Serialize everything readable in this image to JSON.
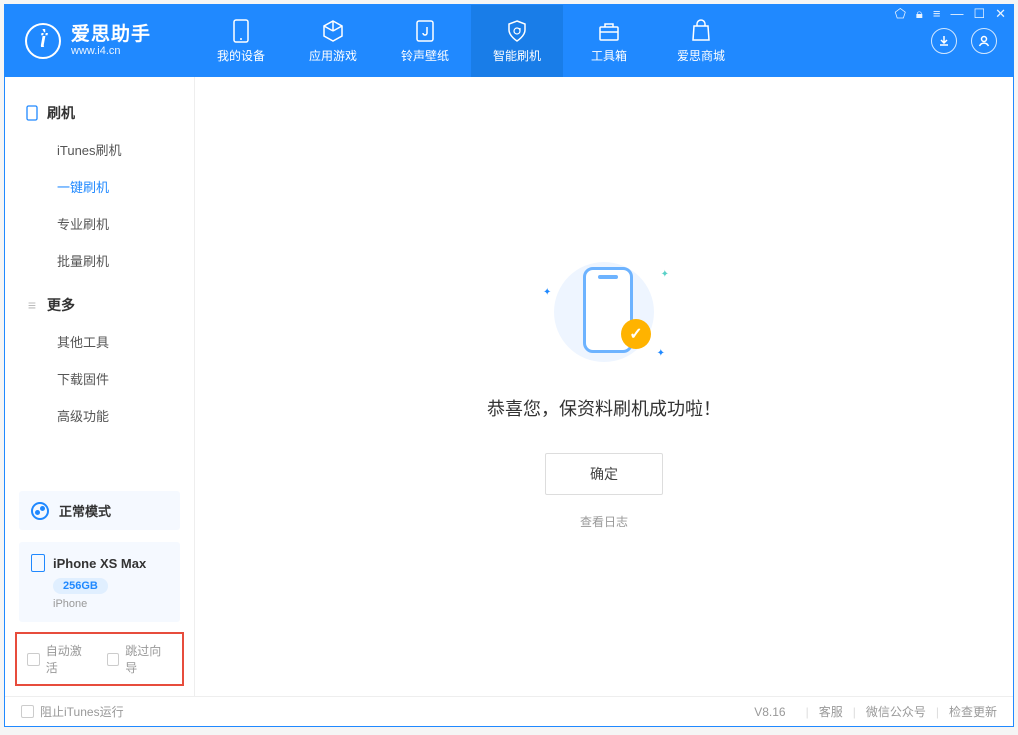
{
  "app": {
    "name": "爱思助手",
    "website": "www.i4.cn"
  },
  "nav": {
    "items": [
      {
        "label": "我的设备"
      },
      {
        "label": "应用游戏"
      },
      {
        "label": "铃声壁纸"
      },
      {
        "label": "智能刷机"
      },
      {
        "label": "工具箱"
      },
      {
        "label": "爱思商城"
      }
    ]
  },
  "sidebar": {
    "section1": {
      "title": "刷机",
      "items": [
        "iTunes刷机",
        "一键刷机",
        "专业刷机",
        "批量刷机"
      ]
    },
    "section2": {
      "title": "更多",
      "items": [
        "其他工具",
        "下载固件",
        "高级功能"
      ]
    },
    "mode": "正常模式",
    "device": {
      "name": "iPhone XS Max",
      "capacity": "256GB",
      "type": "iPhone"
    },
    "options": {
      "auto_activate": "自动激活",
      "skip_guide": "跳过向导"
    }
  },
  "main": {
    "success_message": "恭喜您，保资料刷机成功啦！",
    "ok_button": "确定",
    "view_log": "查看日志"
  },
  "footer": {
    "block_itunes": "阻止iTunes运行",
    "version": "V8.16",
    "links": [
      "客服",
      "微信公众号",
      "检查更新"
    ]
  }
}
